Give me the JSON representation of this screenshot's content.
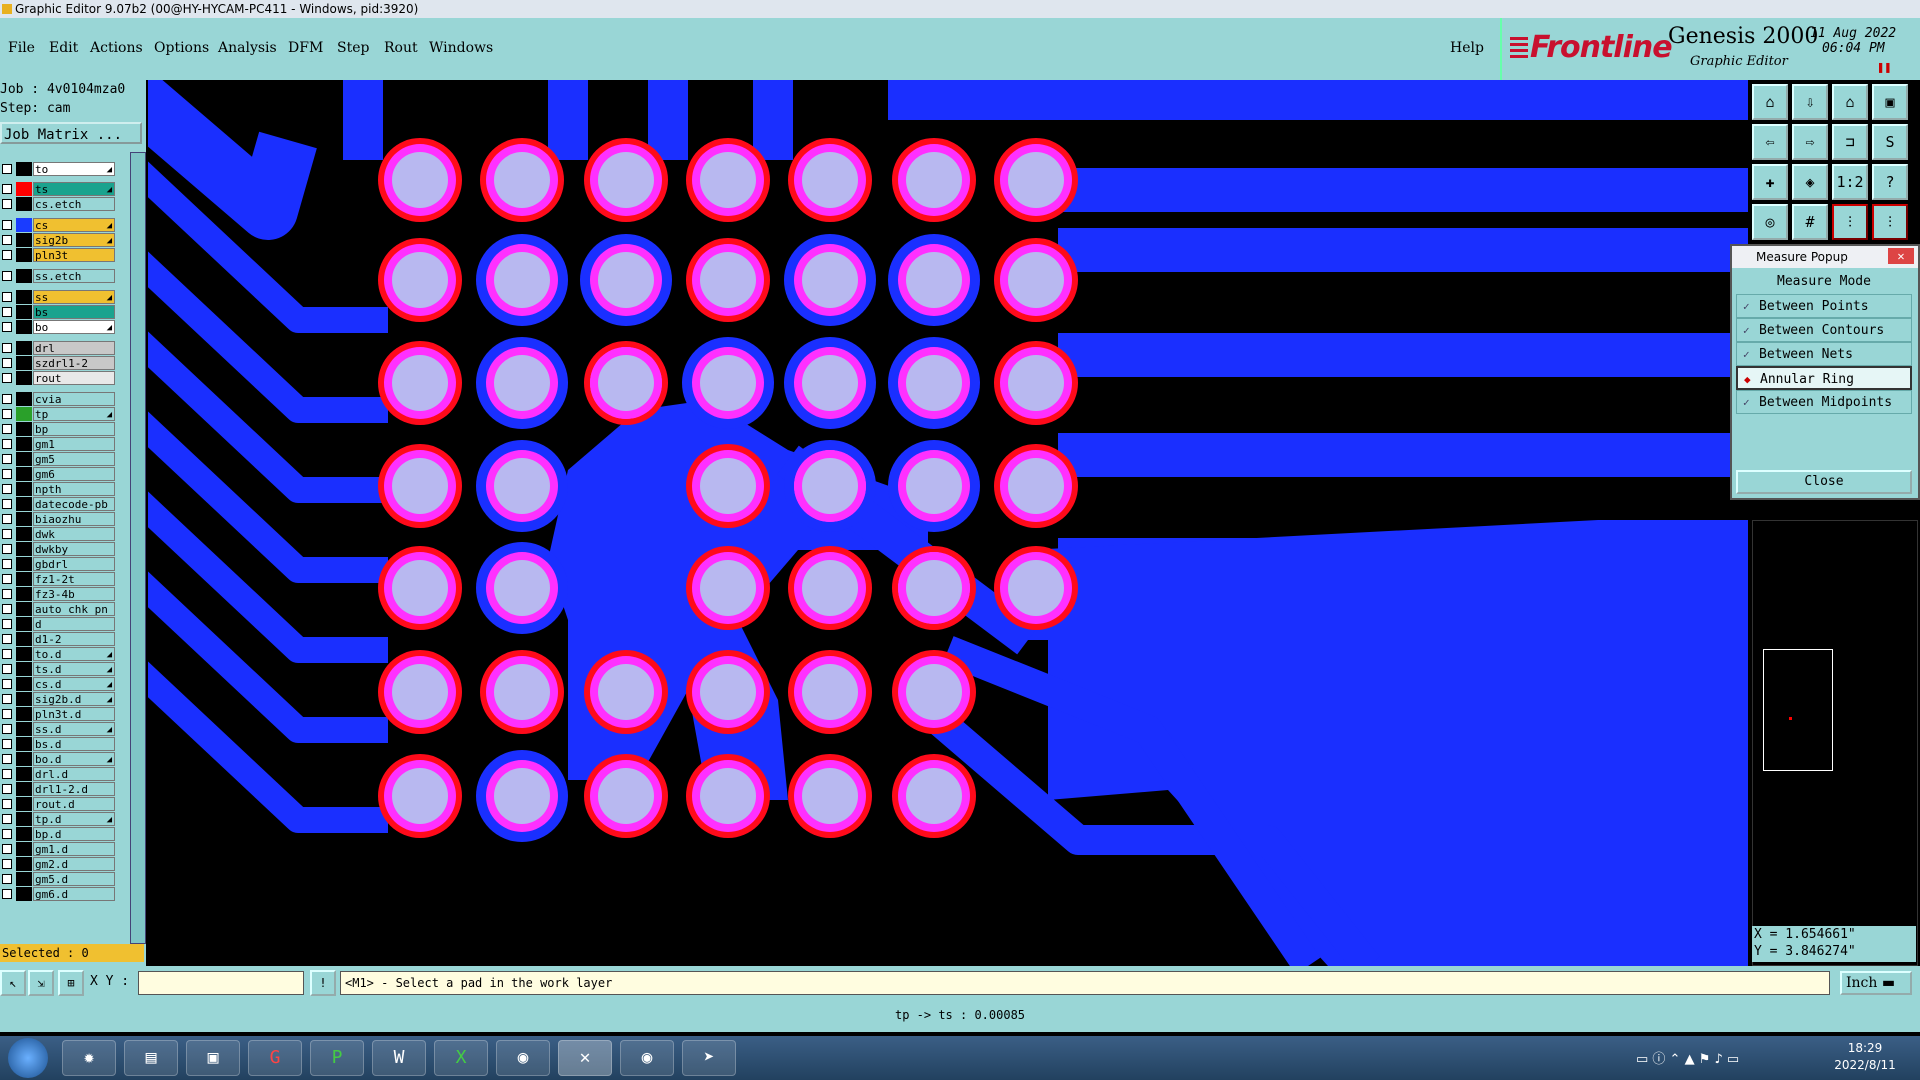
{
  "window": {
    "title": "Graphic Editor 9.07b2 (00@HY-HYCAM-PC411 - Windows, pid:3920)"
  },
  "menu": [
    "File",
    "Edit",
    "Actions",
    "Options",
    "Analysis",
    "DFM",
    "Step",
    "Rout",
    "Windows"
  ],
  "help": "Help",
  "brand": {
    "frontline": "Frontline",
    "genesis": "Genesis 2000",
    "editor": "Graphic Editor",
    "date": "11 Aug 2022",
    "time": "06:04 PM"
  },
  "job": {
    "job_line": "Job : 4v0104mza0",
    "step_line": "Step: cam",
    "matrix_button": "Job Matrix ..."
  },
  "layers": [
    {
      "name": "to",
      "color": "#ffffff",
      "swatch": "#000000",
      "arrow": true
    },
    {
      "name": "ts",
      "color": "#1aa38e",
      "swatch": "#ff0000",
      "arrow": true
    },
    {
      "name": "cs.etch",
      "color": "#99d6d6",
      "swatch": "#000000",
      "arrow": false
    },
    {
      "name": "cs",
      "color": "#f0c030",
      "swatch": "#1a3cff",
      "arrow": true
    },
    {
      "name": "sig2b",
      "color": "#f0c030",
      "swatch": "#000000",
      "arrow": true
    },
    {
      "name": "pln3t",
      "color": "#f0c030",
      "swatch": "#000000",
      "arrow": false
    },
    {
      "name": "ss.etch",
      "color": "#99d6d6",
      "swatch": "#000000",
      "arrow": false
    },
    {
      "name": "ss",
      "color": "#f0c030",
      "swatch": "#000000",
      "arrow": true
    },
    {
      "name": "bs",
      "color": "#1aa38e",
      "swatch": "#000000",
      "arrow": false
    },
    {
      "name": "bo",
      "color": "#ffffff",
      "swatch": "#000000",
      "arrow": true
    },
    {
      "name": "drl",
      "color": "#c8c8c8",
      "swatch": "#000000",
      "arrow": false
    },
    {
      "name": "szdrl1-2",
      "color": "#c8c8c8",
      "swatch": "#000000",
      "arrow": false
    },
    {
      "name": "rout",
      "color": "#e8e8e8",
      "swatch": "#000000",
      "arrow": false
    },
    {
      "name": "cvia",
      "color": "#99d6d6",
      "swatch": "#000000",
      "arrow": false
    },
    {
      "name": "tp",
      "color": "#99d6d6",
      "swatch": "#2aa02a",
      "arrow": true
    },
    {
      "name": "bp",
      "color": "#99d6d6",
      "swatch": "#000000",
      "arrow": false
    },
    {
      "name": "gm1",
      "color": "#99d6d6",
      "swatch": "#000000",
      "arrow": false
    },
    {
      "name": "gm5",
      "color": "#99d6d6",
      "swatch": "#000000",
      "arrow": false
    },
    {
      "name": "gm6",
      "color": "#99d6d6",
      "swatch": "#000000",
      "arrow": false
    },
    {
      "name": "npth",
      "color": "#99d6d6",
      "swatch": "#000000",
      "arrow": false
    },
    {
      "name": "datecode-pb",
      "color": "#99d6d6",
      "swatch": "#000000",
      "arrow": false
    },
    {
      "name": "biaozhu",
      "color": "#99d6d6",
      "swatch": "#000000",
      "arrow": false
    },
    {
      "name": "dwk",
      "color": "#99d6d6",
      "swatch": "#000000",
      "arrow": false
    },
    {
      "name": "dwkby",
      "color": "#99d6d6",
      "swatch": "#000000",
      "arrow": false
    },
    {
      "name": "gbdrl",
      "color": "#99d6d6",
      "swatch": "#000000",
      "arrow": false
    },
    {
      "name": "fz1-2t",
      "color": "#99d6d6",
      "swatch": "#000000",
      "arrow": false
    },
    {
      "name": "fz3-4b",
      "color": "#99d6d6",
      "swatch": "#000000",
      "arrow": false
    },
    {
      "name": "auto_chk_pn",
      "color": "#99d6d6",
      "swatch": "#000000",
      "arrow": false
    },
    {
      "name": "d",
      "color": "#99d6d6",
      "swatch": "#000000",
      "arrow": false
    },
    {
      "name": "d1-2",
      "color": "#99d6d6",
      "swatch": "#000000",
      "arrow": false
    },
    {
      "name": "to.d",
      "color": "#99d6d6",
      "swatch": "#000000",
      "arrow": true
    },
    {
      "name": "ts.d",
      "color": "#99d6d6",
      "swatch": "#000000",
      "arrow": true
    },
    {
      "name": "cs.d",
      "color": "#99d6d6",
      "swatch": "#000000",
      "arrow": true
    },
    {
      "name": "sig2b.d",
      "color": "#99d6d6",
      "swatch": "#000000",
      "arrow": true
    },
    {
      "name": "pln3t.d",
      "color": "#99d6d6",
      "swatch": "#000000",
      "arrow": false
    },
    {
      "name": "ss.d",
      "color": "#99d6d6",
      "swatch": "#000000",
      "arrow": true
    },
    {
      "name": "bs.d",
      "color": "#99d6d6",
      "swatch": "#000000",
      "arrow": false
    },
    {
      "name": "bo.d",
      "color": "#99d6d6",
      "swatch": "#000000",
      "arrow": true
    },
    {
      "name": "drl.d",
      "color": "#99d6d6",
      "swatch": "#000000",
      "arrow": false
    },
    {
      "name": "drl1-2.d",
      "color": "#99d6d6",
      "swatch": "#000000",
      "arrow": false
    },
    {
      "name": "rout.d",
      "color": "#99d6d6",
      "swatch": "#000000",
      "arrow": false
    },
    {
      "name": "tp.d",
      "color": "#99d6d6",
      "swatch": "#000000",
      "arrow": true
    },
    {
      "name": "bp.d",
      "color": "#99d6d6",
      "swatch": "#000000",
      "arrow": false
    },
    {
      "name": "gm1.d",
      "color": "#99d6d6",
      "swatch": "#000000",
      "arrow": false
    },
    {
      "name": "gm2.d",
      "color": "#99d6d6",
      "swatch": "#000000",
      "arrow": false
    },
    {
      "name": "gm5.d",
      "color": "#99d6d6",
      "swatch": "#000000",
      "arrow": false
    },
    {
      "name": "gm6.d",
      "color": "#99d6d6",
      "swatch": "#000000",
      "arrow": false
    }
  ],
  "selected": "Selected : 0",
  "toolbar": {
    "one_to_two": "1:2",
    "help_q": "?"
  },
  "measure": {
    "title": "Measure Popup",
    "mode_label": "Measure Mode",
    "options": [
      "Between Points",
      "Between Contours",
      "Between Nets",
      "Annular Ring",
      "Between Midpoints"
    ],
    "active_index": 3,
    "close": "Close"
  },
  "coords": {
    "x": "X = 1.654661\"",
    "y": "Y = 3.846274\""
  },
  "cmd": {
    "xy_label": "X Y :",
    "prompt": "<M1> - Select a pad in the work layer",
    "units": "Inch"
  },
  "status": "tp -> ts : 0.00085",
  "clock": {
    "time": "18:29",
    "date": "2022/8/11"
  },
  "colors": {
    "teal": "#99d6d6",
    "copper_blue": "#1a2fff",
    "red": "#ff0a1a",
    "magenta": "#ff30ff",
    "pad": "#b8b8f0"
  }
}
